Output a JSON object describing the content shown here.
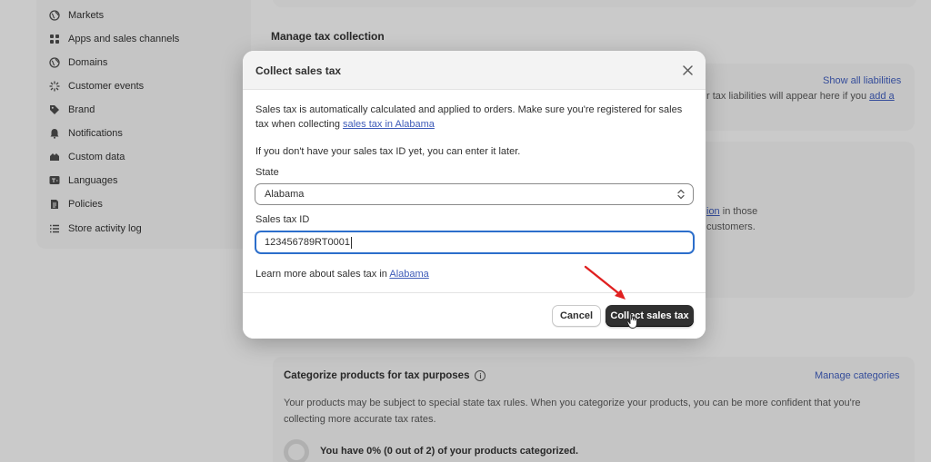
{
  "sidebar": {
    "items": [
      {
        "label": "Markets",
        "icon": "globe-icon"
      },
      {
        "label": "Apps and sales channels",
        "icon": "apps-icon"
      },
      {
        "label": "Domains",
        "icon": "globe-icon"
      },
      {
        "label": "Customer events",
        "icon": "sparkle-icon"
      },
      {
        "label": "Brand",
        "icon": "tag-icon"
      },
      {
        "label": "Notifications",
        "icon": "bell-icon"
      },
      {
        "label": "Custom data",
        "icon": "database-icon"
      },
      {
        "label": "Languages",
        "icon": "translate-icon"
      },
      {
        "label": "Policies",
        "icon": "document-icon"
      },
      {
        "label": "Store activity log",
        "icon": "list-icon"
      }
    ]
  },
  "main": {
    "section_title": "Manage tax collection",
    "liabilities": {
      "link": "Show all liabilities",
      "text_partial": "r tax liabilities will appear here if you ",
      "text_link_partial": "add a"
    },
    "mid_card": {
      "link_partial": "ion",
      "text_line1_partial": " in those",
      "text_line2_partial": "customers."
    },
    "categorize": {
      "title": "Categorize products for tax purposes",
      "link": "Manage categories",
      "description_line1": "Your products may be subject to special state tax rules. When you categorize your products, you can be more confident that you're",
      "description_line2": "collecting more accurate tax rates.",
      "progress_text": "You have 0% (0 out of 2) of your products categorized.",
      "progress_fraction": 0
    }
  },
  "modal": {
    "title": "Collect sales tax",
    "intro_text": "Sales tax is automatically calculated and applied to orders. Make sure you're registered for sales tax when collecting ",
    "intro_link": "sales tax in Alabama",
    "note_text": "If you don't have your sales tax ID yet, you can enter it later.",
    "state_label": "State",
    "state_value": "Alabama",
    "tax_id_label": "Sales tax ID",
    "tax_id_value": "123456789RT0001",
    "learn_more_text": "Learn more about sales tax in ",
    "learn_more_link": "Alabama",
    "cancel_label": "Cancel",
    "primary_label": "Collect sales tax"
  },
  "colors": {
    "accent_link": "#3e5bb8",
    "primary_button": "#303030",
    "focus_ring": "#2c6ecb",
    "annotation_arrow": "#e02020"
  }
}
